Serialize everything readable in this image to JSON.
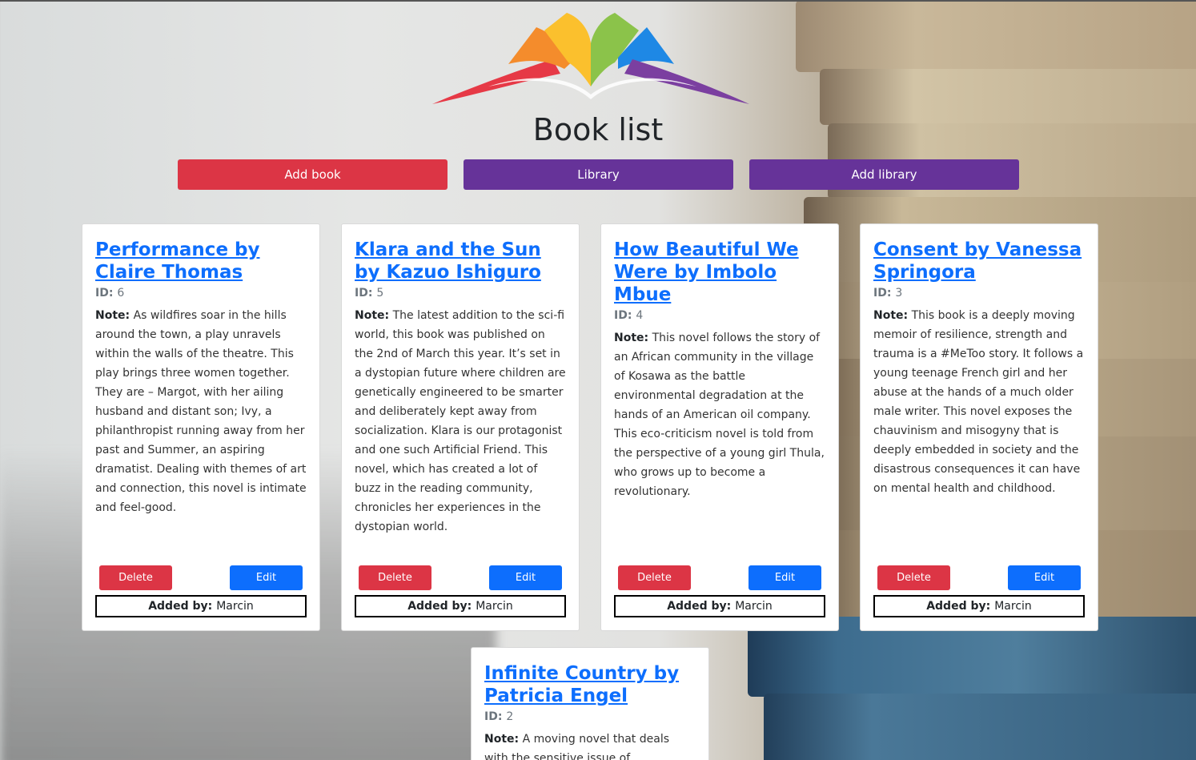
{
  "page": {
    "title": "Book list"
  },
  "nav": {
    "add_book": "Add book",
    "library": "Library",
    "add_library": "Add library"
  },
  "colors": {
    "red": "#dc3545",
    "purple": "#663399",
    "blue": "#0d6efd"
  },
  "card_labels": {
    "id_label": "ID:",
    "note_label": "Note:",
    "delete": "Delete",
    "edit": "Edit",
    "added_by_label": "Added by:"
  },
  "books": [
    {
      "title": "Performance by Claire Thomas",
      "id": "6",
      "note": "As wildfires soar in the hills around the town, a play unravels within the walls of the theatre. This play brings three women together. They are – Margot, with her ailing husband and distant son; Ivy, a philanthropist running away from her past and Summer, an aspiring dramatist. Dealing with themes of art and connection, this novel is intimate and feel-good.",
      "added_by": "Marcin"
    },
    {
      "title": "Klara and the Sun by Kazuo Ishiguro",
      "id": "5",
      "note": "The latest addition to the sci-fi world, this book was published on the 2nd of March this year. It’s set in a dystopian future where children are genetically engineered to be smarter and deliberately kept away from socialization. Klara is our protagonist and one such Artificial Friend. This novel, which has created a lot of buzz in the reading community, chronicles her experiences in the dystopian world.",
      "added_by": "Marcin"
    },
    {
      "title": "How Beautiful We Were by Imbolo Mbue",
      "id": "4",
      "note": "This novel follows the story of an African community in the village of Kosawa as the battle environmental degradation at the hands of an American oil company. This eco-criticism novel is told from the perspective of a young girl Thula, who grows up to become a revolutionary.",
      "added_by": "Marcin"
    },
    {
      "title": "Consent by Vanessa Springora",
      "id": "3",
      "note": "This book is a deeply moving memoir of resilience, strength and trauma is a #MeToo story. It follows a young teenage French girl and her abuse at the hands of a much older male writer. This novel exposes the chauvinism and misogyny that is deeply embedded in society and the disastrous consequences it can have on mental health and childhood.",
      "added_by": "Marcin"
    },
    {
      "title": "Infinite Country by Patricia Engel",
      "id": "2",
      "note": "A moving novel that deals with the sensitive issue of deportation"
    }
  ]
}
